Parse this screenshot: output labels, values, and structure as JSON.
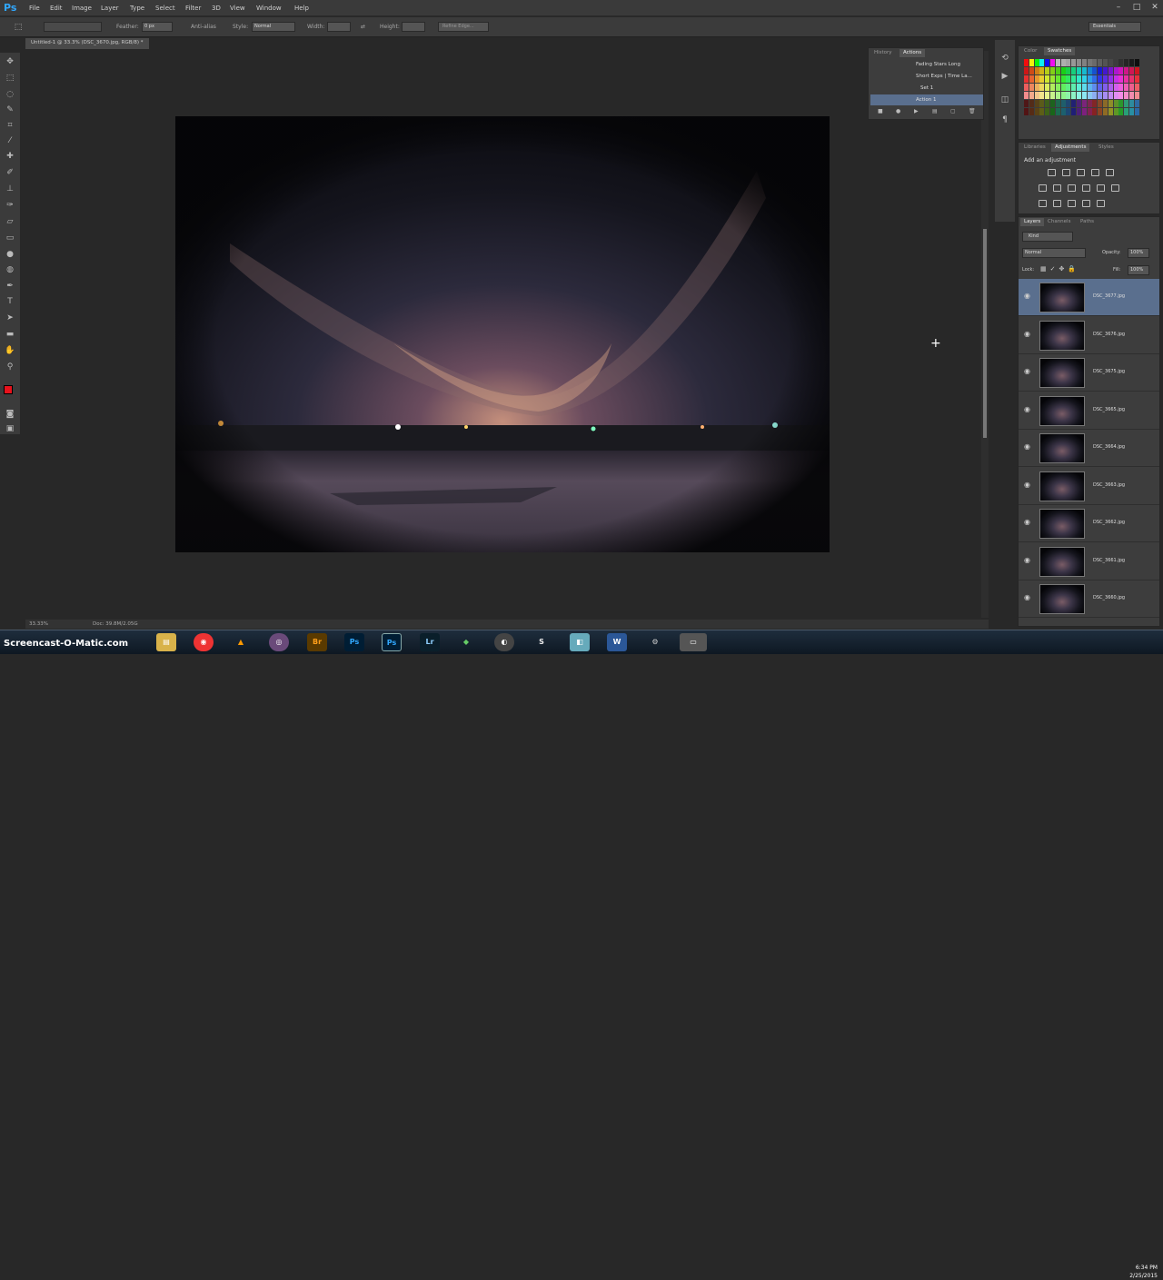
{
  "app": {
    "logo": "Ps"
  },
  "menu": [
    "File",
    "Edit",
    "Image",
    "Layer",
    "Type",
    "Select",
    "Filter",
    "3D",
    "View",
    "Window",
    "Help"
  ],
  "options": {
    "feather_label": "Feather:",
    "feather_value": "0 px",
    "antialias": "Anti-alias",
    "style_label": "Style:",
    "style_value": "Normal",
    "width_label": "Width:",
    "height_label": "Height:",
    "refine": "Refine Edge...",
    "workspace": "Essentials"
  },
  "document": {
    "tab": "Untitled-1 @ 33.3% (DSC_3670.jpg, RGB/8) *"
  },
  "status": {
    "zoom": "33.33%",
    "doc": "Doc: 39.8M/2.05G"
  },
  "history_panel": {
    "tabs": [
      "History",
      "Actions"
    ],
    "actions": [
      "Fading Stars Long",
      "Short Exps | Time La...",
      "Set 1",
      "Action 1"
    ]
  },
  "color_panel": {
    "tabs": [
      "Color",
      "Swatches"
    ]
  },
  "adjust_panel": {
    "tabs": [
      "Libraries",
      "Adjustments",
      "Styles"
    ],
    "title": "Add an adjustment"
  },
  "layers_panel": {
    "tabs": [
      "Layers",
      "Channels",
      "Paths"
    ],
    "kind": "Kind",
    "blend": "Normal",
    "opacity_label": "Opacity:",
    "opacity": "100%",
    "lock_label": "Lock:",
    "fill_label": "Fill:",
    "fill": "100%",
    "layers": [
      "DSC_3677.jpg",
      "DSC_3676.jpg",
      "DSC_3675.jpg",
      "DSC_3665.jpg",
      "DSC_3664.jpg",
      "DSC_3663.jpg",
      "DSC_3662.jpg",
      "DSC_3661.jpg",
      "DSC_3660.jpg"
    ]
  },
  "taskbar": {
    "apps": [
      "Br",
      "Ps",
      "Ps",
      "Lr",
      "W"
    ],
    "time": "6:34 PM",
    "date": "2/25/2015"
  },
  "watermark": "Screencast-O-Matic.com",
  "colors": {
    "foreground": "#e8121c",
    "background": "#ffffff",
    "selected_layer": "#5a6f8e"
  }
}
